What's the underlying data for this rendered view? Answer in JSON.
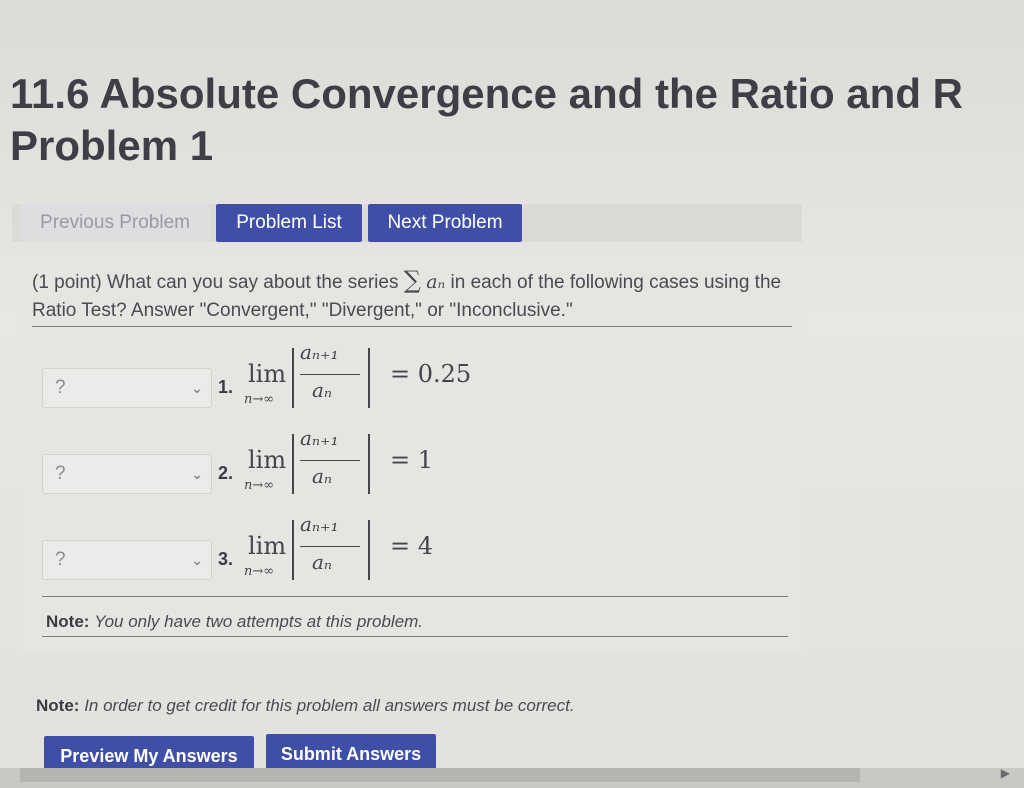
{
  "header": {
    "title": "11.6 Absolute Convergence and the Ratio and R",
    "subtitle": "Problem 1"
  },
  "nav": {
    "previous": "Previous Problem",
    "list": "Problem List",
    "next": "Next Problem"
  },
  "question": {
    "prefix": "(1 point) What can you say about the series",
    "sum_symbol": "∑",
    "term": "aₙ",
    "suffix": "in each of the following cases using the Ratio Test? Answer \"Convergent,\" \"Divergent,\" or \"Inconclusive.\""
  },
  "items": [
    {
      "number": "1.",
      "selected": "?",
      "lim": "lim",
      "sub": "n→∞",
      "numer": "aₙ₊₁",
      "denom": "aₙ",
      "result": "= 0.25"
    },
    {
      "number": "2.",
      "selected": "?",
      "lim": "lim",
      "sub": "n→∞",
      "numer": "aₙ₊₁",
      "denom": "aₙ",
      "result": "= 1"
    },
    {
      "number": "3.",
      "selected": "?",
      "lim": "lim",
      "sub": "n→∞",
      "numer": "aₙ₊₁",
      "denom": "aₙ",
      "result": "= 4"
    }
  ],
  "notes": {
    "attempts_label": "Note:",
    "attempts_text": "You only have two attempts at this problem.",
    "credit_label": "Note:",
    "credit_text": "In order to get credit for this problem all answers must be correct."
  },
  "actions": {
    "preview": "Preview My Answers",
    "submit": "Submit Answers"
  },
  "icons": {
    "chevron": "chevron-down-icon",
    "scroll_right": "scroll-right-arrow-icon"
  },
  "colors": {
    "button": "#3f4fa6",
    "title": "#3f3e47"
  }
}
